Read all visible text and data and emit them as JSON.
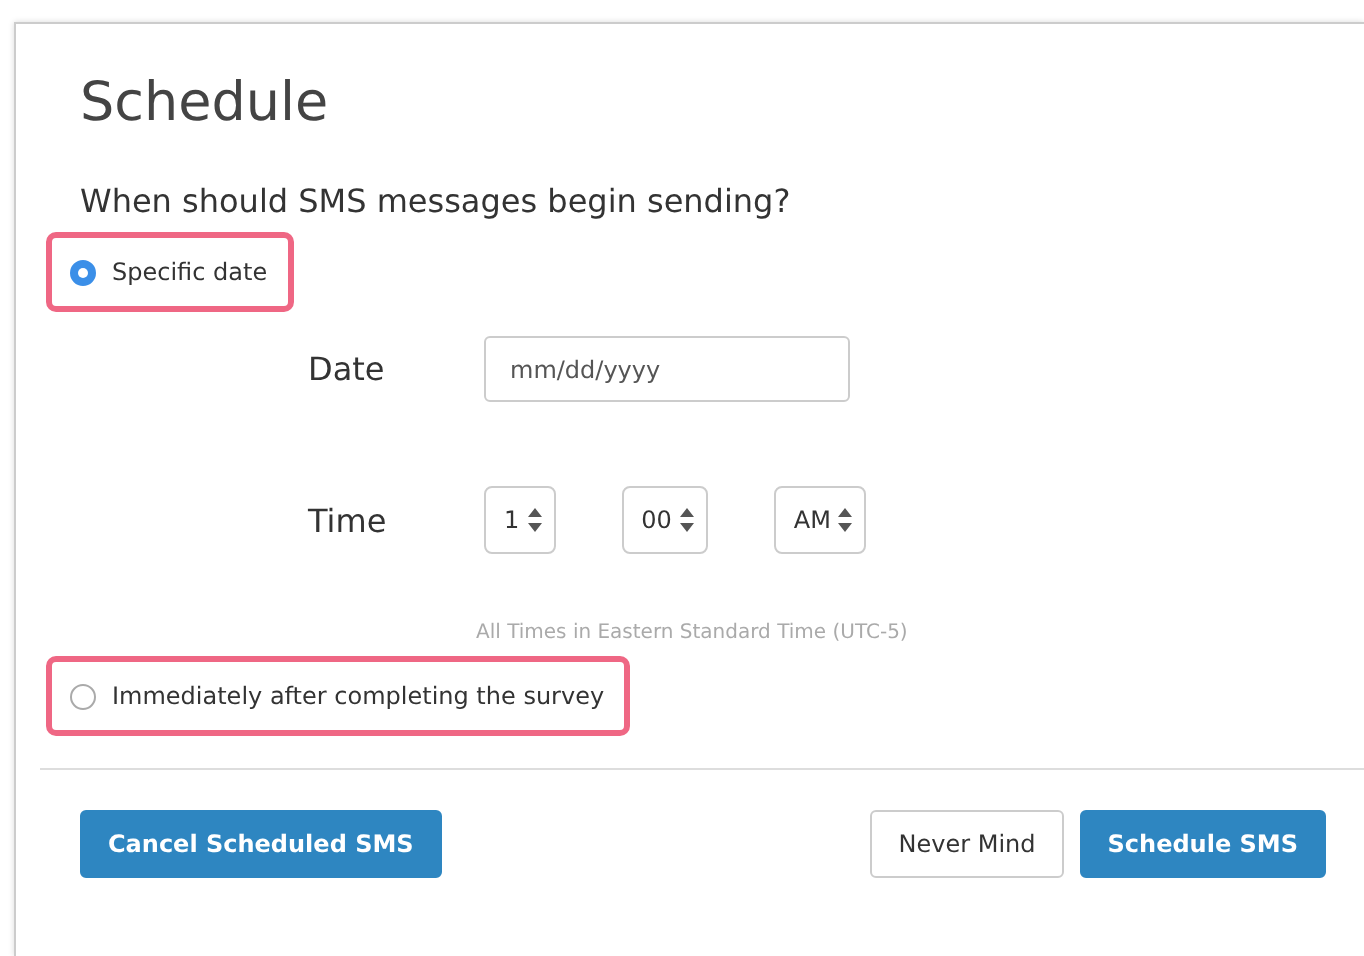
{
  "title": "Schedule",
  "question": "When should SMS messages begin sending?",
  "options": [
    {
      "label": "Specific date",
      "selected": true,
      "highlighted": true
    },
    {
      "label": "Immediately after completing the survey",
      "selected": false,
      "highlighted": true
    }
  ],
  "date": {
    "label": "Date",
    "placeholder": "mm/dd/yyyy"
  },
  "time": {
    "label": "Time",
    "selects": [
      "1",
      "00",
      "AM"
    ]
  },
  "timezone_note": "All Times in Eastern Standard Time (UTC-5)",
  "buttons": [
    {
      "label": "Cancel Scheduled SMS",
      "kind": "primary"
    },
    {
      "label": "Never Mind",
      "kind": "secondary"
    },
    {
      "label": "Schedule SMS",
      "kind": "primary"
    }
  ]
}
